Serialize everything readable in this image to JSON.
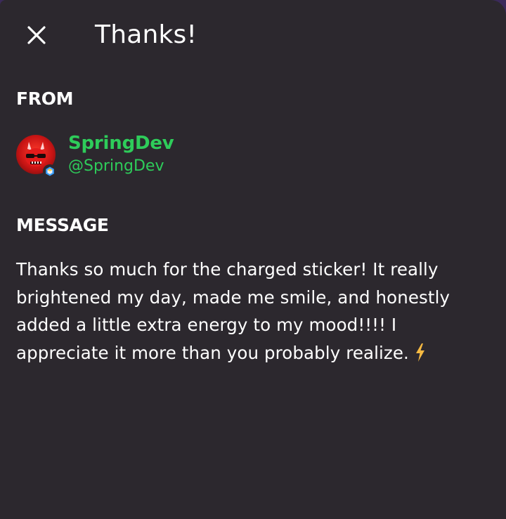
{
  "header": {
    "title": "Thanks!",
    "close_icon": "close-icon"
  },
  "from": {
    "label": "FROM",
    "sender": {
      "display_name": "SpringDev",
      "handle": "@SpringDev",
      "name_color": "#2ecc5a"
    }
  },
  "message": {
    "label": "MESSAGE",
    "body": "Thanks so much for the charged sticker! It really brightened my day, made me smile, and honestly added a little extra energy to my mood!!!! I appreciate it more than you probably realize.",
    "emoji_icon": "lightning-bolt-icon"
  },
  "colors": {
    "background": "#2c282e",
    "text": "#ffffff",
    "accent": "#2ecc5a",
    "bolt": "#f5b942"
  }
}
